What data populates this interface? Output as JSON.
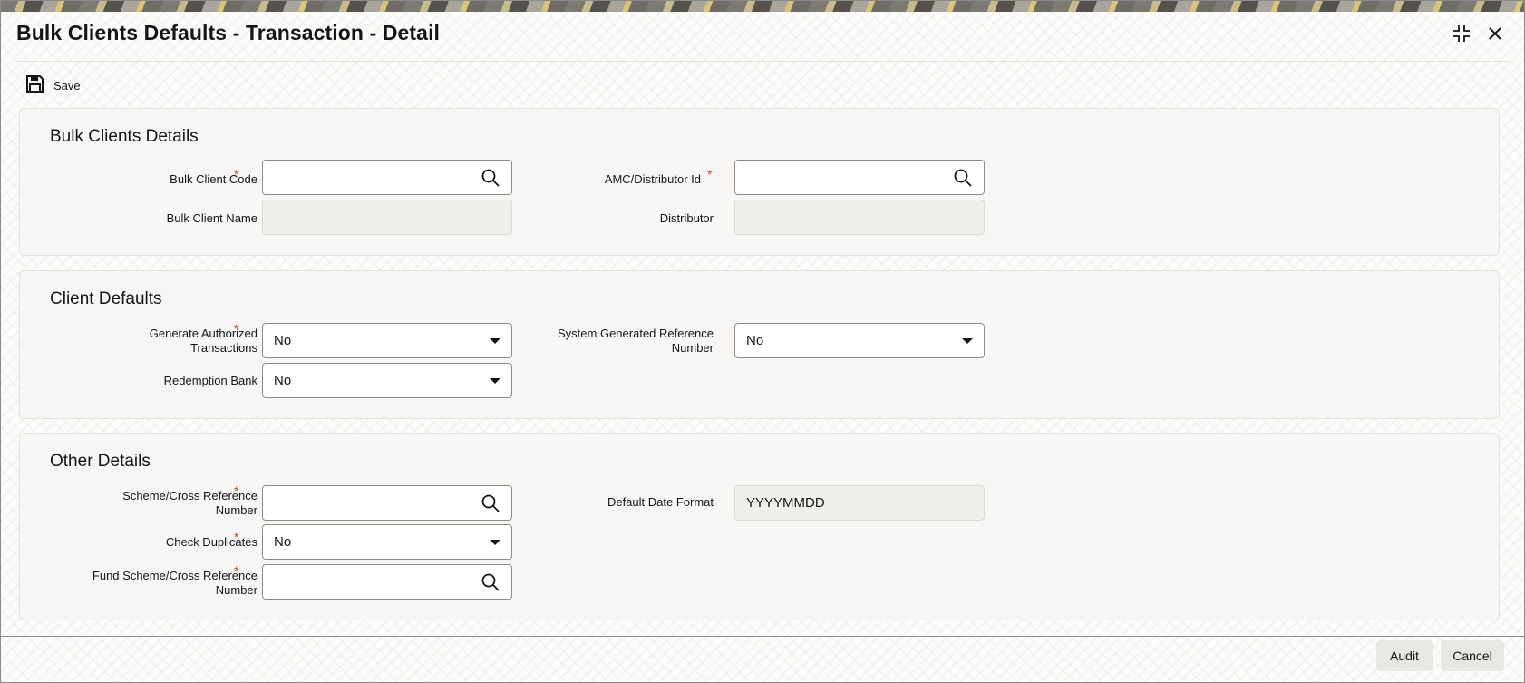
{
  "window": {
    "title": "Bulk Clients Defaults - Transaction - Detail"
  },
  "toolbar": {
    "save_label": "Save"
  },
  "sections": {
    "bulk_clients": {
      "title": "Bulk Clients Details",
      "bulk_client_code": {
        "label": "Bulk Client Code",
        "required": "*",
        "value": ""
      },
      "amc_distributor_id": {
        "label": "AMC/Distributor Id",
        "required": "*",
        "value": ""
      },
      "bulk_client_name": {
        "label": "Bulk Client Name",
        "value": ""
      },
      "distributor": {
        "label": "Distributor",
        "value": ""
      }
    },
    "client_defaults": {
      "title": "Client Defaults",
      "generate_authorized": {
        "label_line1": "Generate Authorized",
        "label_line2": "Transactions",
        "required": "*",
        "value": "No"
      },
      "system_generated_ref": {
        "label_line1": "System Generated Reference",
        "label_line2": "Number",
        "value": "No"
      },
      "redemption_bank": {
        "label": "Redemption Bank",
        "value": "No"
      }
    },
    "other_details": {
      "title": "Other Details",
      "scheme_cross_ref": {
        "label_line1": "Scheme/Cross Reference",
        "label_line2": "Number",
        "required": "*",
        "value": ""
      },
      "default_date_format": {
        "label": "Default Date Format",
        "value": "YYYYMMDD"
      },
      "check_duplicates": {
        "label": "Check Duplicates",
        "required": "*",
        "value": "No"
      },
      "fund_scheme_cross_ref": {
        "label_line1": "Fund Scheme/Cross Reference",
        "label_line2": "Number",
        "required": "*",
        "value": ""
      }
    }
  },
  "footer": {
    "audit_label": "Audit",
    "cancel_label": "Cancel"
  },
  "icons": {
    "minimize": "collapse-icon",
    "close": "close-icon",
    "save": "floppy-disk-icon",
    "lookup": "search-icon",
    "dropdown": "chevron-down-icon"
  },
  "colors": {
    "required": "#c74634",
    "section_bg": "#f7f6f4",
    "field_border": "#8f8b84"
  }
}
